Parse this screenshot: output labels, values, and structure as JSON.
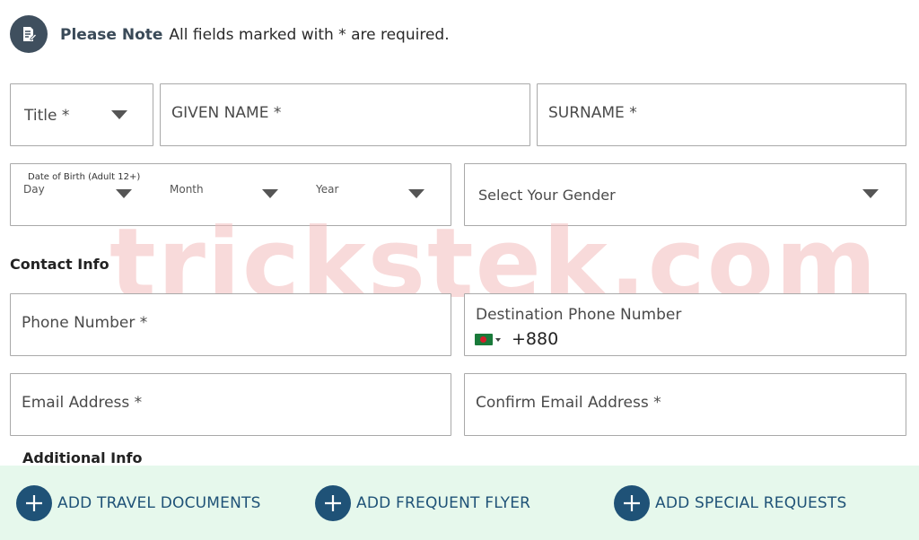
{
  "note": {
    "title": "Please Note",
    "text": "All fields marked with * are required."
  },
  "fields": {
    "title": "Title *",
    "given_name": "GIVEN NAME *",
    "surname": "SURNAME *",
    "dob_label": "Date of Birth (Adult 12+)",
    "dob_day": "Day",
    "dob_month": "Month",
    "dob_year": "Year",
    "gender": "Select Your Gender"
  },
  "contact": {
    "heading": "Contact Info",
    "phone": "Phone Number *",
    "dest_phone_label": "Destination Phone Number",
    "dial_code": "+880",
    "email": "Email Address *",
    "confirm_email": "Confirm Email Address *"
  },
  "additional": {
    "heading": "Additional Info",
    "buttons": [
      "ADD TRAVEL DOCUMENTS",
      "ADD FREQUENT FLYER",
      "ADD SPECIAL REQUESTS"
    ]
  },
  "watermark": "trickstek.com",
  "colors": {
    "accent": "#1f5277",
    "bar_bg": "#e6f8ec",
    "note_icon_bg": "#3f4f5e",
    "border": "#a9a9a9"
  },
  "icons": [
    "note-edit-icon",
    "chevron-down-icon",
    "plus-icon",
    "bangladesh-flag-icon"
  ]
}
